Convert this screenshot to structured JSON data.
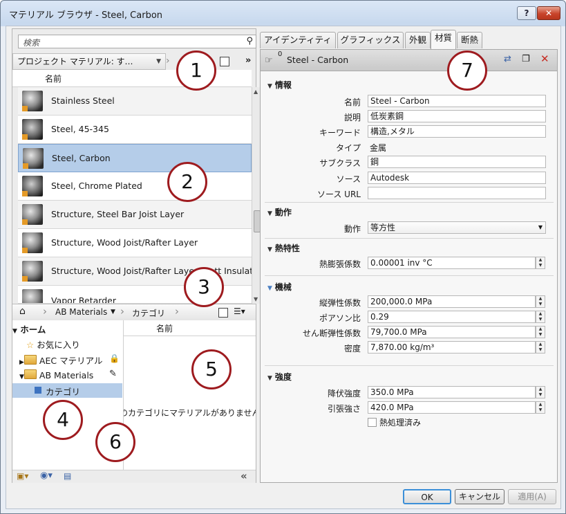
{
  "window": {
    "title": "マテリアル ブラウザ - Steel, Carbon",
    "help_label": "?",
    "close_label": "✕"
  },
  "left": {
    "search_placeholder": "検索",
    "doc_selector": "プロジェクト マテリアル: す…",
    "more_label": "»",
    "column_name": "名前",
    "materials": [
      {
        "name": "Stainless Steel"
      },
      {
        "name": "Steel, 45-345"
      },
      {
        "name": "Steel, Carbon"
      },
      {
        "name": "Steel, Chrome Plated"
      },
      {
        "name": "Structure, Steel Bar Joist Layer"
      },
      {
        "name": "Structure, Wood Joist/Rafter Layer"
      },
      {
        "name": "Structure, Wood Joist/Rafter Layer, Batt Insulation"
      },
      {
        "name": "Vapor Retarder"
      }
    ],
    "library_crumbs": [
      "AB Materials",
      "カテゴリ"
    ],
    "tree": {
      "home": "ホーム",
      "favorites": "お気に入り",
      "aec": "AEC マテリアル",
      "ab": "AB Materials",
      "category": "カテゴリ"
    },
    "list_column_name": "名前",
    "empty_message": "このカテゴリにマテリアルがありません",
    "collapse_label": "«"
  },
  "tabs": [
    "アイデンティティ",
    "グラフィックス",
    "外観",
    "材質",
    "断熱"
  ],
  "active_tab": "材質",
  "material": {
    "count_label": "0",
    "title": "Steel - Carbon",
    "sections": {
      "info": "情報",
      "behavior": "動作",
      "thermal": "熱特性",
      "mechanical": "機械",
      "strength": "強度"
    },
    "info": {
      "name_label": "名前",
      "name_value": "Steel - Carbon",
      "desc_label": "説明",
      "desc_value": "低炭素鋼",
      "keyword_label": "キーワード",
      "keyword_value": "構造,メタル",
      "type_label": "タイプ",
      "type_value": "金属",
      "subclass_label": "サブクラス",
      "subclass_value": "鋼",
      "source_label": "ソース",
      "source_value": "Autodesk",
      "url_label": "ソース URL",
      "url_value": ""
    },
    "behavior": {
      "label": "動作",
      "value": "等方性"
    },
    "thermal": {
      "label": "熱膨張係数",
      "value": "0.00001 inv °C"
    },
    "mechanical": {
      "young_label": "縦弾性係数",
      "young_value": "200,000.0 MPa",
      "poisson_label": "ポアソン比",
      "poisson_value": "0.29",
      "shear_label": "せん断弾性係数",
      "shear_value": "79,700.0 MPa",
      "density_label": "密度",
      "density_value": "7,870.00 kg/m³"
    },
    "strength": {
      "yield_label": "降伏強度",
      "yield_value": "350.0 MPa",
      "tensile_label": "引張強さ",
      "tensile_value": "420.0 MPa",
      "heat_label": "熱処理済み"
    }
  },
  "buttons": {
    "ok": "OK",
    "cancel": "キャンセル",
    "apply": "適用(A)"
  },
  "callouts": [
    "1",
    "2",
    "3",
    "4",
    "5",
    "6",
    "7"
  ]
}
